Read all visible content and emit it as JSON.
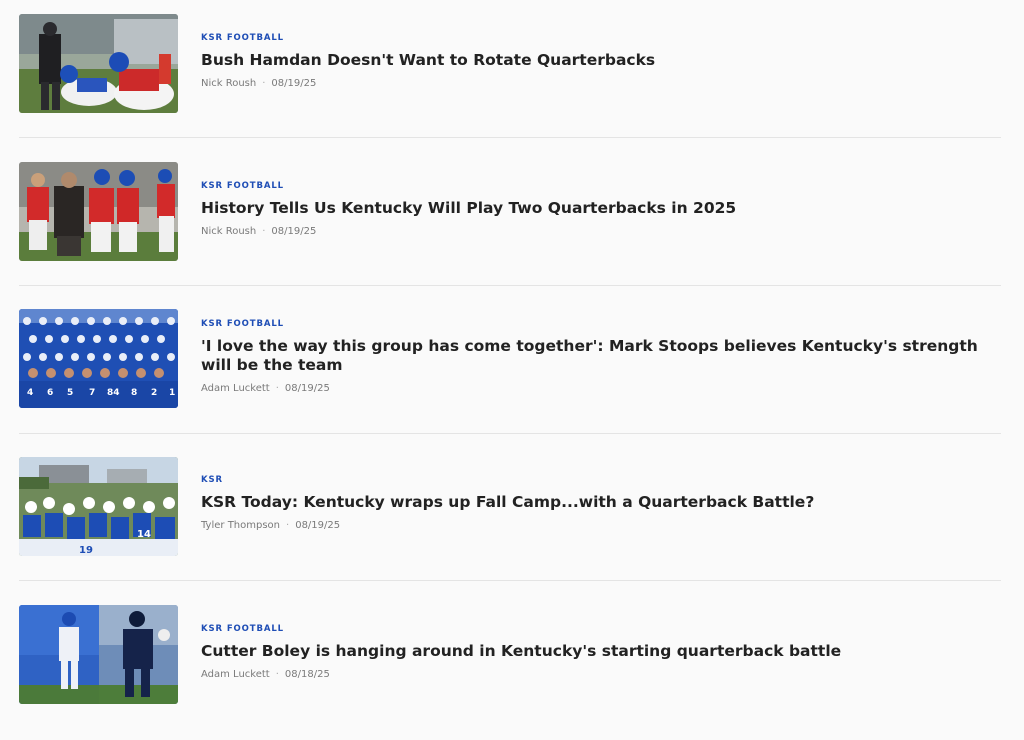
{
  "articles": [
    {
      "category": "KSR FOOTBALL",
      "title": "Bush Hamdan Doesn't Want to Rotate Quarterbacks",
      "author": "Nick Roush",
      "separator": "·",
      "date": "08/19/25"
    },
    {
      "category": "KSR FOOTBALL",
      "title": "History Tells Us Kentucky Will Play Two Quarterbacks in 2025",
      "author": "Nick Roush",
      "separator": "·",
      "date": "08/19/25"
    },
    {
      "category": "KSR FOOTBALL",
      "title": "'I love the way this group has come together': Mark Stoops believes Kentucky's strength will be the team",
      "author": "Adam Luckett",
      "separator": "·",
      "date": "08/19/25"
    },
    {
      "category": "KSR",
      "title": "KSR Today: Kentucky wraps up Fall Camp...with a Quarterback Battle?",
      "author": "Tyler Thompson",
      "separator": "·",
      "date": "08/19/25"
    },
    {
      "category": "KSR FOOTBALL",
      "title": "Cutter Boley is hanging around in Kentucky's starting quarterback battle",
      "author": "Adam Luckett",
      "separator": "·",
      "date": "08/18/25"
    }
  ],
  "colors": {
    "category": "#1e4db5",
    "title": "#222222",
    "meta": "#7a7a7a",
    "divider": "#e4e4e4",
    "kentucky_blue": "#1b4fb0"
  }
}
